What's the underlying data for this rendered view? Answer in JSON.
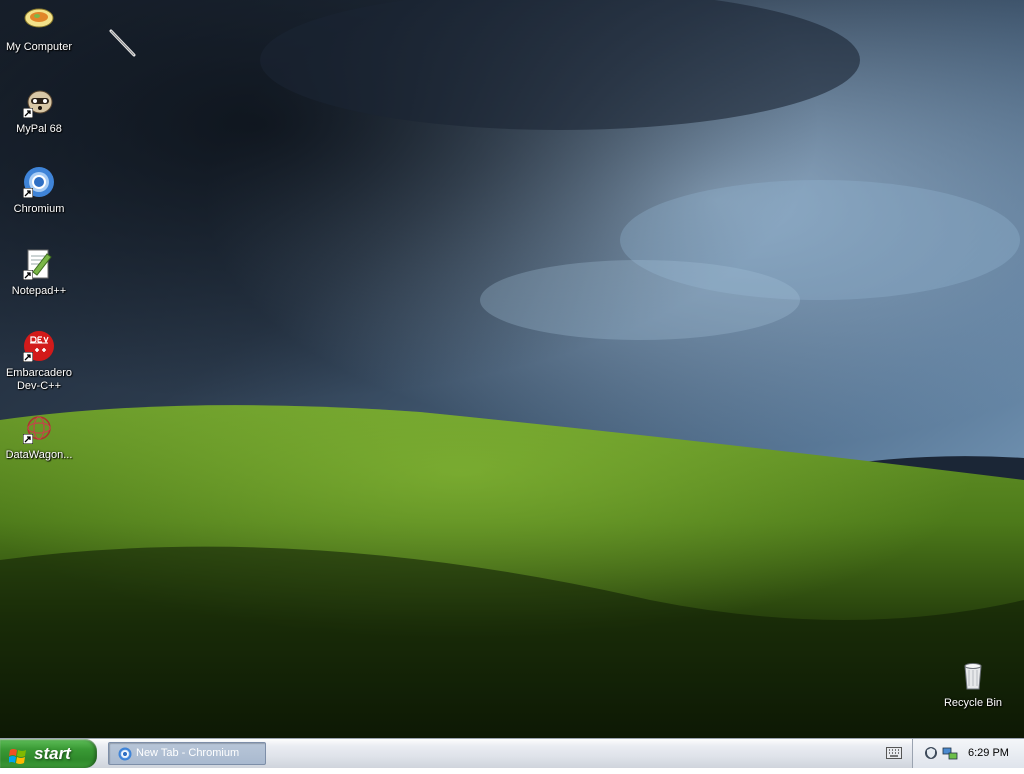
{
  "desktop": {
    "icons": [
      {
        "label": "My Computer"
      },
      {
        "label": "MyPal 68"
      },
      {
        "label": "Chromium"
      },
      {
        "label": "Notepad++"
      },
      {
        "label": "Embarcadero Dev-C++"
      },
      {
        "label": "DataWagon..."
      }
    ],
    "recycle_bin": {
      "label": "Recycle Bin"
    }
  },
  "taskbar": {
    "start_label": "start",
    "tasks": [
      {
        "label": "New Tab - Chromium",
        "icon": "chromium-icon"
      }
    ],
    "tray": {
      "clock": "6:29 PM",
      "icons": [
        "keyboard-icon",
        "security-shield-icon",
        "network-icon"
      ]
    }
  },
  "colors": {
    "start_green": "#3a9a35",
    "taskbar_bg": "#dfe3ea",
    "task_active": "#a9b9cf"
  }
}
